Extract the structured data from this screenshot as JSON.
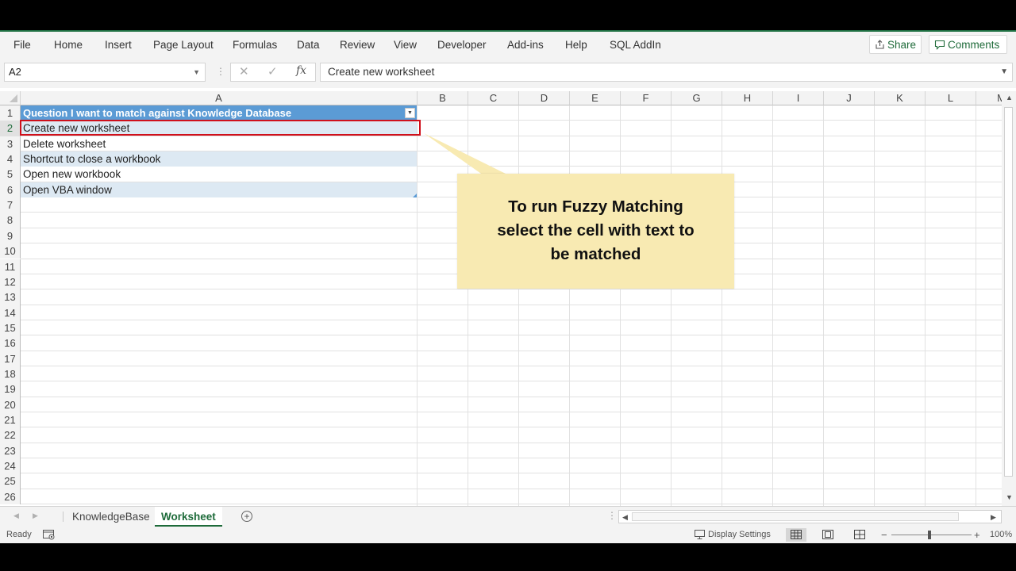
{
  "ribbon": {
    "tabs": [
      "File",
      "Home",
      "Insert",
      "Page Layout",
      "Formulas",
      "Data",
      "Review",
      "View",
      "Developer",
      "Add-ins",
      "Help",
      "SQL AddIn"
    ],
    "share_label": "Share",
    "comments_label": "Comments"
  },
  "formula_bar": {
    "name_box": "A2",
    "fx_label": "fx",
    "formula_value": "Create new worksheet"
  },
  "grid": {
    "column_headers": [
      "A",
      "B",
      "C",
      "D",
      "E",
      "F",
      "G",
      "H",
      "I",
      "J",
      "K",
      "L",
      "M"
    ],
    "row_numbers": [
      "1",
      "2",
      "3",
      "4",
      "5",
      "6",
      "7",
      "8",
      "9",
      "10",
      "11",
      "12",
      "13",
      "14",
      "15",
      "16",
      "17",
      "18",
      "19",
      "20",
      "21",
      "22",
      "23",
      "24",
      "25",
      "26"
    ],
    "table_header": "Question I want to match against Knowledge Database",
    "rows": [
      "Create new worksheet",
      "Delete worksheet",
      "Shortcut to close a workbook",
      "Open new workbook",
      "Open VBA window"
    ],
    "selected_cell": "A2"
  },
  "callout": {
    "line1": "To run Fuzzy Matching",
    "line2": "select the cell with text to",
    "line3": "be matched"
  },
  "sheets": {
    "tabs": [
      "KnowledgeBase",
      "Worksheet"
    ],
    "active": "Worksheet"
  },
  "status_bar": {
    "ready": "Ready",
    "display_settings": "Display Settings",
    "zoom_minus": "−",
    "zoom_plus": "+",
    "zoom": "100%"
  },
  "colors": {
    "accent_green": "#1f7244",
    "table_header_blue": "#5b9bd5",
    "table_band": "#dde9f3",
    "selection_red": "#d0101b",
    "callout_fill": "#f8eab2"
  }
}
